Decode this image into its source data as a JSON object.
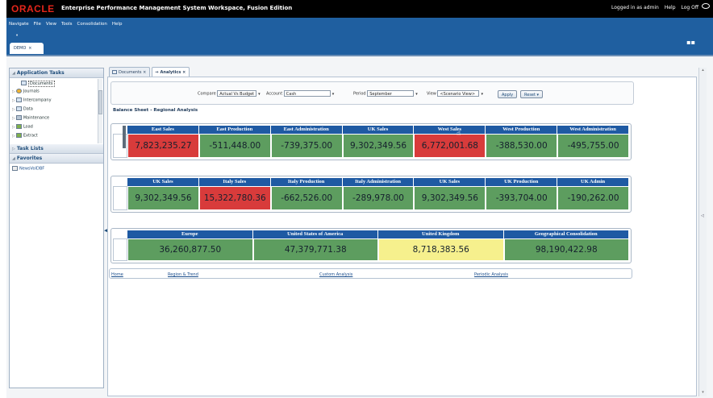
{
  "header": {
    "logo": "ORACLE",
    "title": "Enterprise Performance Management System Workspace, Fusion Edition",
    "logged_in": "Logged in as admin",
    "help": "Help",
    "logoff": "Log Off"
  },
  "menu": {
    "items": [
      "Navigate",
      "File",
      "View",
      "Tools",
      "Consolidation",
      "Help"
    ],
    "right": "▪▪"
  },
  "workspace_tab": {
    "label": "DEMO",
    "close": "×"
  },
  "left_panel": {
    "application_tasks": "Application Tasks",
    "tree": [
      "Documents",
      "Journals",
      "Intercompany",
      "Data",
      "Maintenance",
      "Load",
      "Extract"
    ],
    "task_lists": "Task Lists",
    "favorites": "Favorites",
    "favorite_items": [
      "NewsVolDBF"
    ]
  },
  "doc_tabs": [
    {
      "label": "Documents",
      "close": "×"
    },
    {
      "label": "Analytics",
      "close": "×"
    }
  ],
  "pov": {
    "compare_label": "Compare",
    "compare_value": "Actual Vs Budget",
    "account_label": "Account",
    "account_value": "Cash",
    "period_label": "Period",
    "period_value": "September",
    "view_label": "View",
    "view_value": "<Scenario View>",
    "apply": "Apply",
    "reset": "Reset"
  },
  "grid_title": "Balance Sheet - Regional Analysis",
  "grids": [
    {
      "headers": [
        "East Sales",
        "East Production",
        "East Administration",
        "UK Sales",
        "West Sales",
        "West Production",
        "West Administration"
      ],
      "values": [
        "7,823,235.27",
        "-511,448.00",
        "-739,375.00",
        "9,302,349.56",
        "6,772,001.68",
        "-388,530.00",
        "-495,755.00"
      ],
      "colors": [
        "red",
        "green",
        "green",
        "green",
        "red",
        "green",
        "green"
      ]
    },
    {
      "headers": [
        "UK Sales",
        "Italy Sales",
        "Italy Production",
        "Italy Administration",
        "UK Sales",
        "UK Production",
        "UK Admin"
      ],
      "values": [
        "9,302,349.56",
        "15,322,780.36",
        "-662,526.00",
        "-289,978.00",
        "9,302,349.56",
        "-393,704.00",
        "-190,262.00"
      ],
      "colors": [
        "green",
        "red",
        "green",
        "green",
        "green",
        "green",
        "green"
      ]
    },
    {
      "headers": [
        "Europe",
        "United States of America",
        "United Kingdom",
        "Geographical Consolidation"
      ],
      "values": [
        "36,260,877.50",
        "47,379,771.38",
        "8,718,383.56",
        "98,190,422.98"
      ],
      "colors": [
        "green",
        "green",
        "yellow",
        "green"
      ]
    }
  ],
  "links": [
    "Home",
    "Region & Trend",
    "Custom Analysis",
    "Periodic Analysis"
  ],
  "colors": {
    "header_blue": "#1f5aa3",
    "good": "#5d9d5f",
    "bad": "#d83b3b",
    "warn": "#f6f08d",
    "menubar": "#1f5fa0"
  }
}
